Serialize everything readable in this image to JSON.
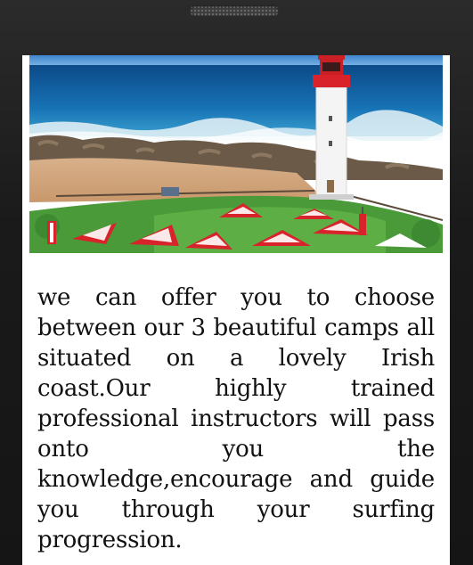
{
  "device": {
    "frame_color": "#1f1f1f",
    "speaker_icon": "speaker-grille-icon"
  },
  "hero": {
    "image_alt": "Lighthouse on a rocky coast with red and white striped umbrellas",
    "colors": {
      "sky": "#4a8fd2",
      "ocean": "#0e4f8e",
      "lighthouse_red": "#d8232a",
      "grass": "#4a9a3a",
      "sand": "#d9b48a"
    }
  },
  "content": {
    "intro_text": "we can offer you to choose between our 3 beautiful camps all situated on a lovely Irish coast.Our highly trained professional instructors will pass onto you the knowledge,encourage and guide you through your surfing progression."
  }
}
